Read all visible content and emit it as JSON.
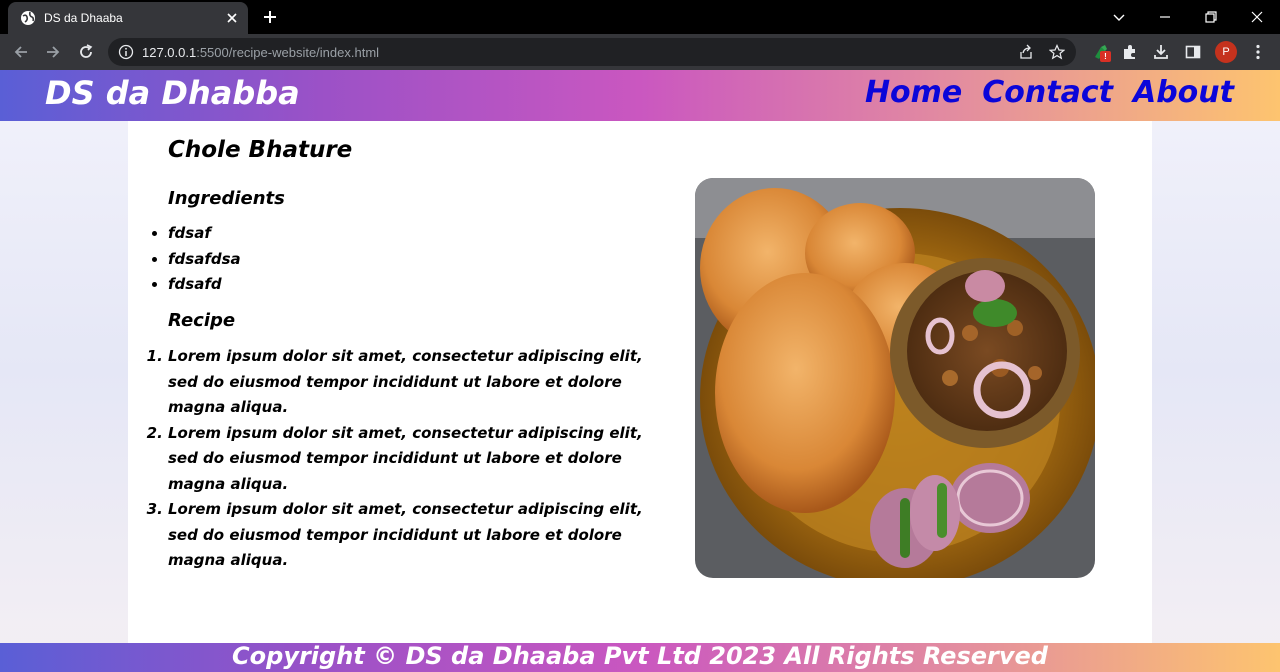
{
  "browser": {
    "tab_title": "DS da Dhaaba",
    "url_host": "127.0.0.1",
    "url_rest": ":5500/recipe-website/index.html",
    "profile_initial": "P",
    "extension_badge": "!"
  },
  "header": {
    "brand": "DS da Dhabba",
    "nav": [
      "Home",
      "Contact",
      "About"
    ]
  },
  "recipe": {
    "title": "Chole Bhature",
    "ingredients_heading": "Ingredients",
    "ingredients": [
      "fdsaf",
      "fdsafdsa",
      "fdsafd"
    ],
    "recipe_heading": "Recipe",
    "steps": [
      "Lorem ipsum dolor sit amet, consectetur adipiscing elit, sed do eiusmod tempor incididunt ut labore et dolore magna aliqua.",
      "Lorem ipsum dolor sit amet, consectetur adipiscing elit, sed do eiusmod tempor incididunt ut labore et dolore magna aliqua.",
      "Lorem ipsum dolor sit amet, consectetur adipiscing elit, sed do eiusmod tempor incididunt ut labore et dolore magna aliqua."
    ],
    "image_icon": "chole-bhature-photo"
  },
  "footer": {
    "text": "Copyright © DS da Dhaaba Pvt Ltd 2023 All Rights Reserved"
  },
  "colors": {
    "nav_link": "#0b05d9",
    "header_gradient": [
      "#5a5fd6",
      "#ca57c0",
      "#fdc46f"
    ]
  }
}
